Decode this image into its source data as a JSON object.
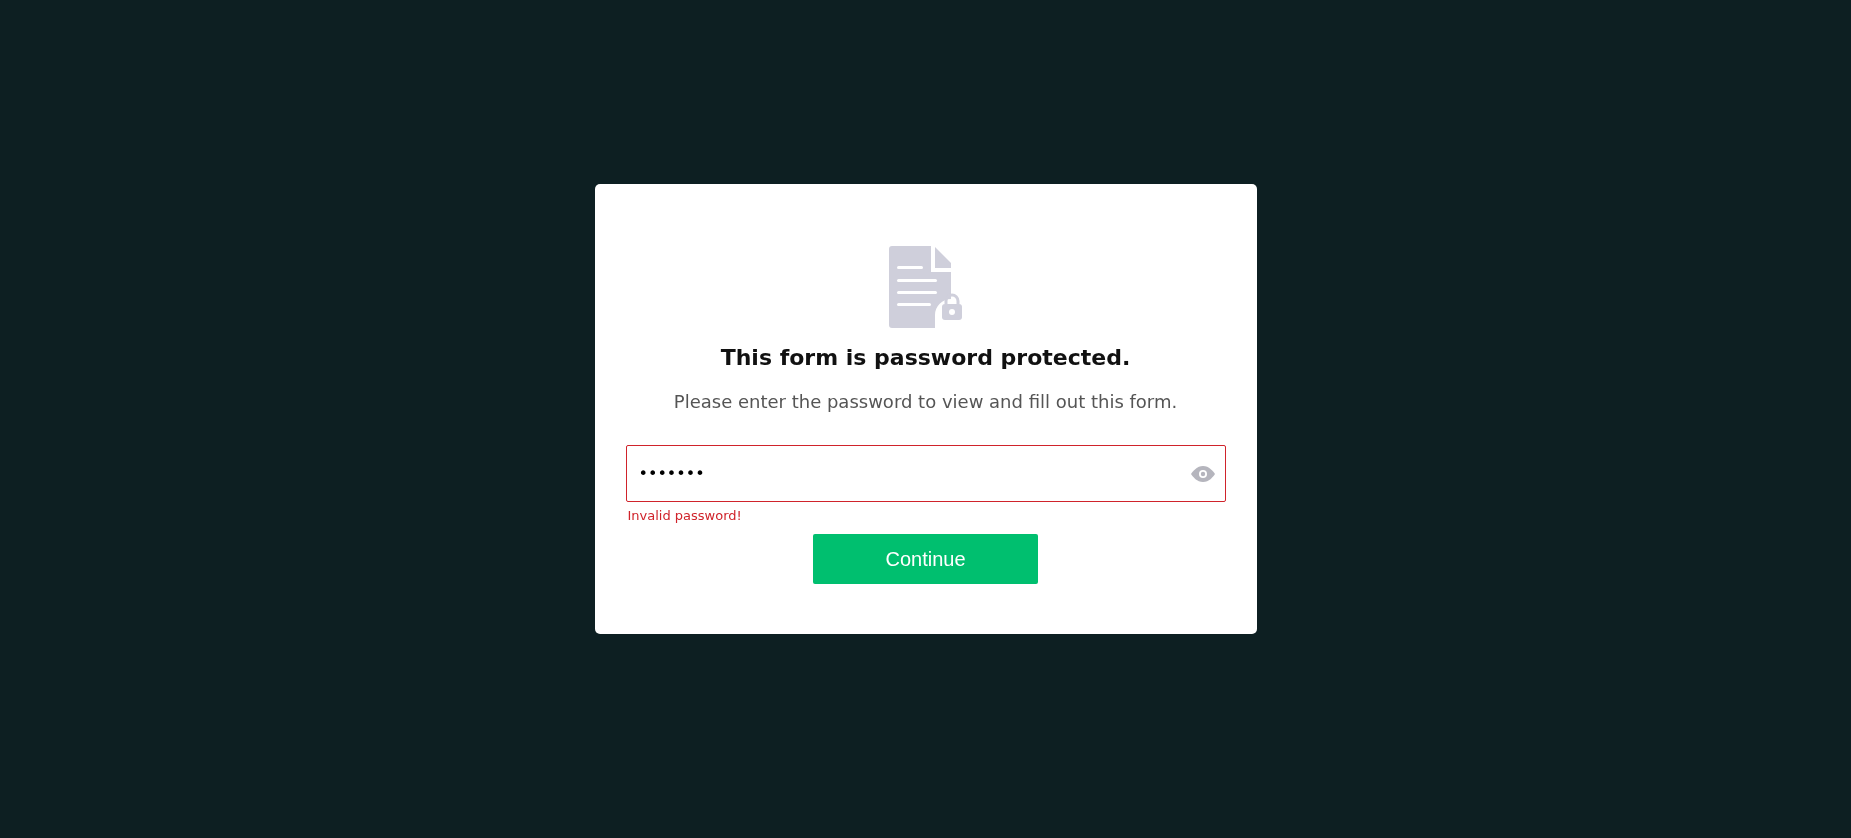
{
  "dialog": {
    "title": "This form is password protected.",
    "message": "Please enter the password to view and fill out this form.",
    "password_field": {
      "value": "•••••••",
      "invalid": true
    },
    "error": "Invalid password!",
    "button": "Continue"
  }
}
